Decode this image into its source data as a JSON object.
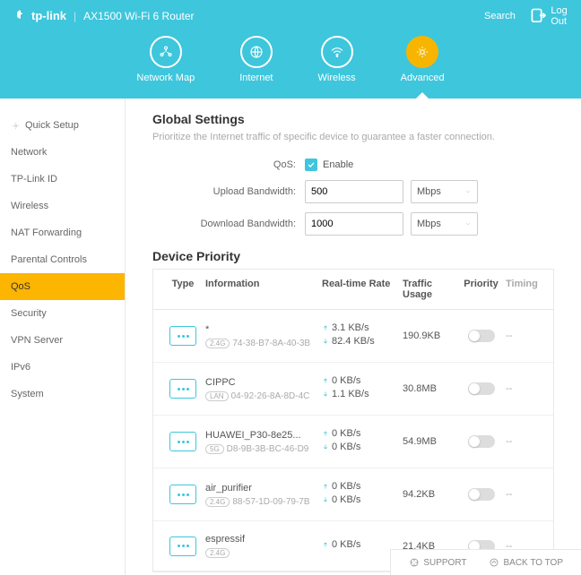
{
  "header": {
    "brand": "tp-link",
    "model": "AX1500 Wi-Fi 6 Router",
    "search": "Search",
    "logout": "Log Out"
  },
  "nav": {
    "map": "Network Map",
    "internet": "Internet",
    "wireless": "Wireless",
    "advanced": "Advanced"
  },
  "sidebar": {
    "items": [
      "Quick Setup",
      "Network",
      "TP-Link ID",
      "Wireless",
      "NAT Forwarding",
      "Parental Controls",
      "QoS",
      "Security",
      "VPN Server",
      "IPv6",
      "System"
    ]
  },
  "global": {
    "title": "Global Settings",
    "desc": "Prioritize the Internet traffic of specific device to guarantee a faster connection.",
    "qos": "QoS:",
    "enable": "Enable",
    "upload": "Upload Bandwidth:",
    "upval": "500",
    "download": "Download Bandwidth:",
    "downval": "1000",
    "unit": "Mbps"
  },
  "priority": {
    "title": "Device Priority",
    "cols": {
      "type": "Type",
      "info": "Information",
      "rate": "Real-time Rate",
      "usage": "Traffic Usage",
      "pri": "Priority",
      "time": "Timing"
    }
  },
  "devices": [
    {
      "name": "*",
      "band": "2.4G",
      "mac": "74-38-B7-8A-40-3B",
      "up": "3.1 KB/s",
      "down": "82.4 KB/s",
      "usage": "190.9KB"
    },
    {
      "name": "CIPPC",
      "band": "LAN",
      "mac": "04-92-26-8A-8D-4C",
      "up": "0 KB/s",
      "down": "1.1 KB/s",
      "usage": "30.8MB"
    },
    {
      "name": "HUAWEI_P30-8e25...",
      "band": "5G",
      "mac": "D8-9B-3B-BC-46-D9",
      "up": "0 KB/s",
      "down": "0 KB/s",
      "usage": "54.9MB"
    },
    {
      "name": "air_purifier",
      "band": "2.4G",
      "mac": "88-57-1D-09-79-7B",
      "up": "0 KB/s",
      "down": "0 KB/s",
      "usage": "94.2KB"
    },
    {
      "name": "espressif",
      "band": "2.4G",
      "mac": "",
      "up": "0 KB/s",
      "down": "",
      "usage": "21.4KB"
    }
  ],
  "footer": {
    "support": "SUPPORT",
    "top": "BACK TO TOP"
  }
}
